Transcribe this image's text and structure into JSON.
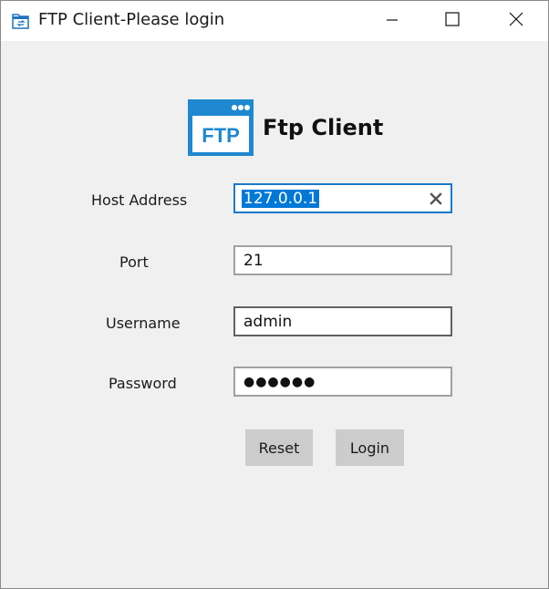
{
  "window": {
    "title": "FTP Client-Please login"
  },
  "brand": {
    "logo_text": "FTP",
    "name": "Ftp Client",
    "accent_color": "#1e88d0"
  },
  "form": {
    "host": {
      "label": "Host Address",
      "value": "127.0.0.1",
      "selected": true
    },
    "port": {
      "label": "Port",
      "value": "21"
    },
    "username": {
      "label": "Username",
      "value": "admin"
    },
    "password": {
      "label": "Password",
      "masked_value": "●●●●●●"
    }
  },
  "buttons": {
    "reset": "Reset",
    "login": "Login"
  },
  "icons": {
    "app": "ftp-folder-icon",
    "minimize": "minimize-icon",
    "maximize": "maximize-icon",
    "close": "close-icon",
    "clear": "clear-x-icon"
  }
}
